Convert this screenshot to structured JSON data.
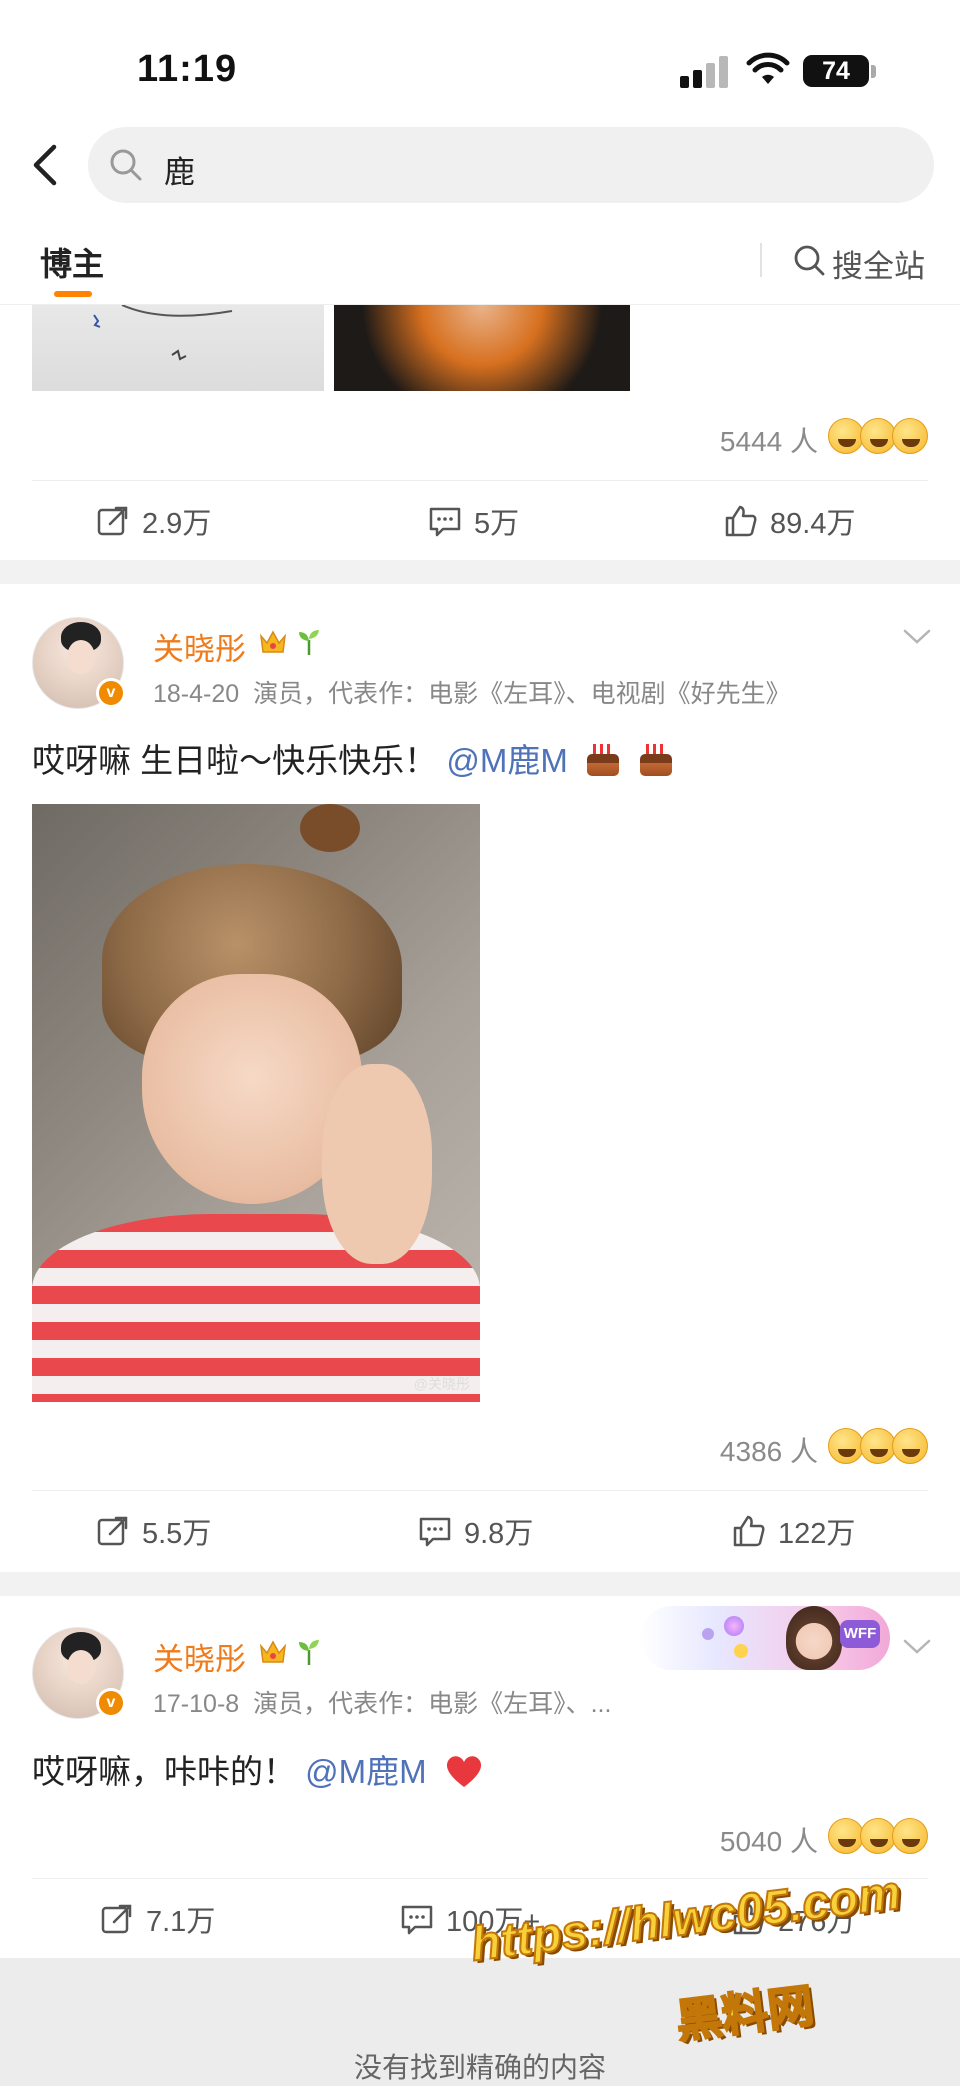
{
  "status_bar": {
    "time": "11:19",
    "battery": "74"
  },
  "search": {
    "query": "鹿"
  },
  "tabs": {
    "active": "博主",
    "search_all": "搜全站"
  },
  "top_post": {
    "reaction_count": "5444 人",
    "repost": "2.9万",
    "comment": "5万",
    "like": "89.4万"
  },
  "post1": {
    "user": "关晓彤",
    "date": "18-4-20",
    "bio": "演员，代表作：电影《左耳》、电视剧《好先生》",
    "text": "哎呀嘛 生日啦～快乐快乐！",
    "mention": "@M鹿M",
    "photo_watermark": "@关晓彤",
    "reaction_count": "4386 人",
    "repost": "5.5万",
    "comment": "9.8万",
    "like": "122万"
  },
  "post2": {
    "user": "关晓彤",
    "date": "17-10-8",
    "bio": "演员，代表作：电影《左耳》、...",
    "text": "哎呀嘛，咔咔的！",
    "mention": "@M鹿M",
    "promo_tag": "WFF",
    "reaction_count": "5040 人",
    "repost": "7.1万",
    "comment": "100万+",
    "like": "276万"
  },
  "footer": {
    "text": "没有找到精确的内容"
  },
  "watermark": {
    "url": "https://hlwc05.com",
    "name": "黑料网"
  },
  "colors": {
    "accent": "#ff8200",
    "username": "#f07b1a",
    "mention": "#4f72b8",
    "badge": "#f08a00"
  }
}
